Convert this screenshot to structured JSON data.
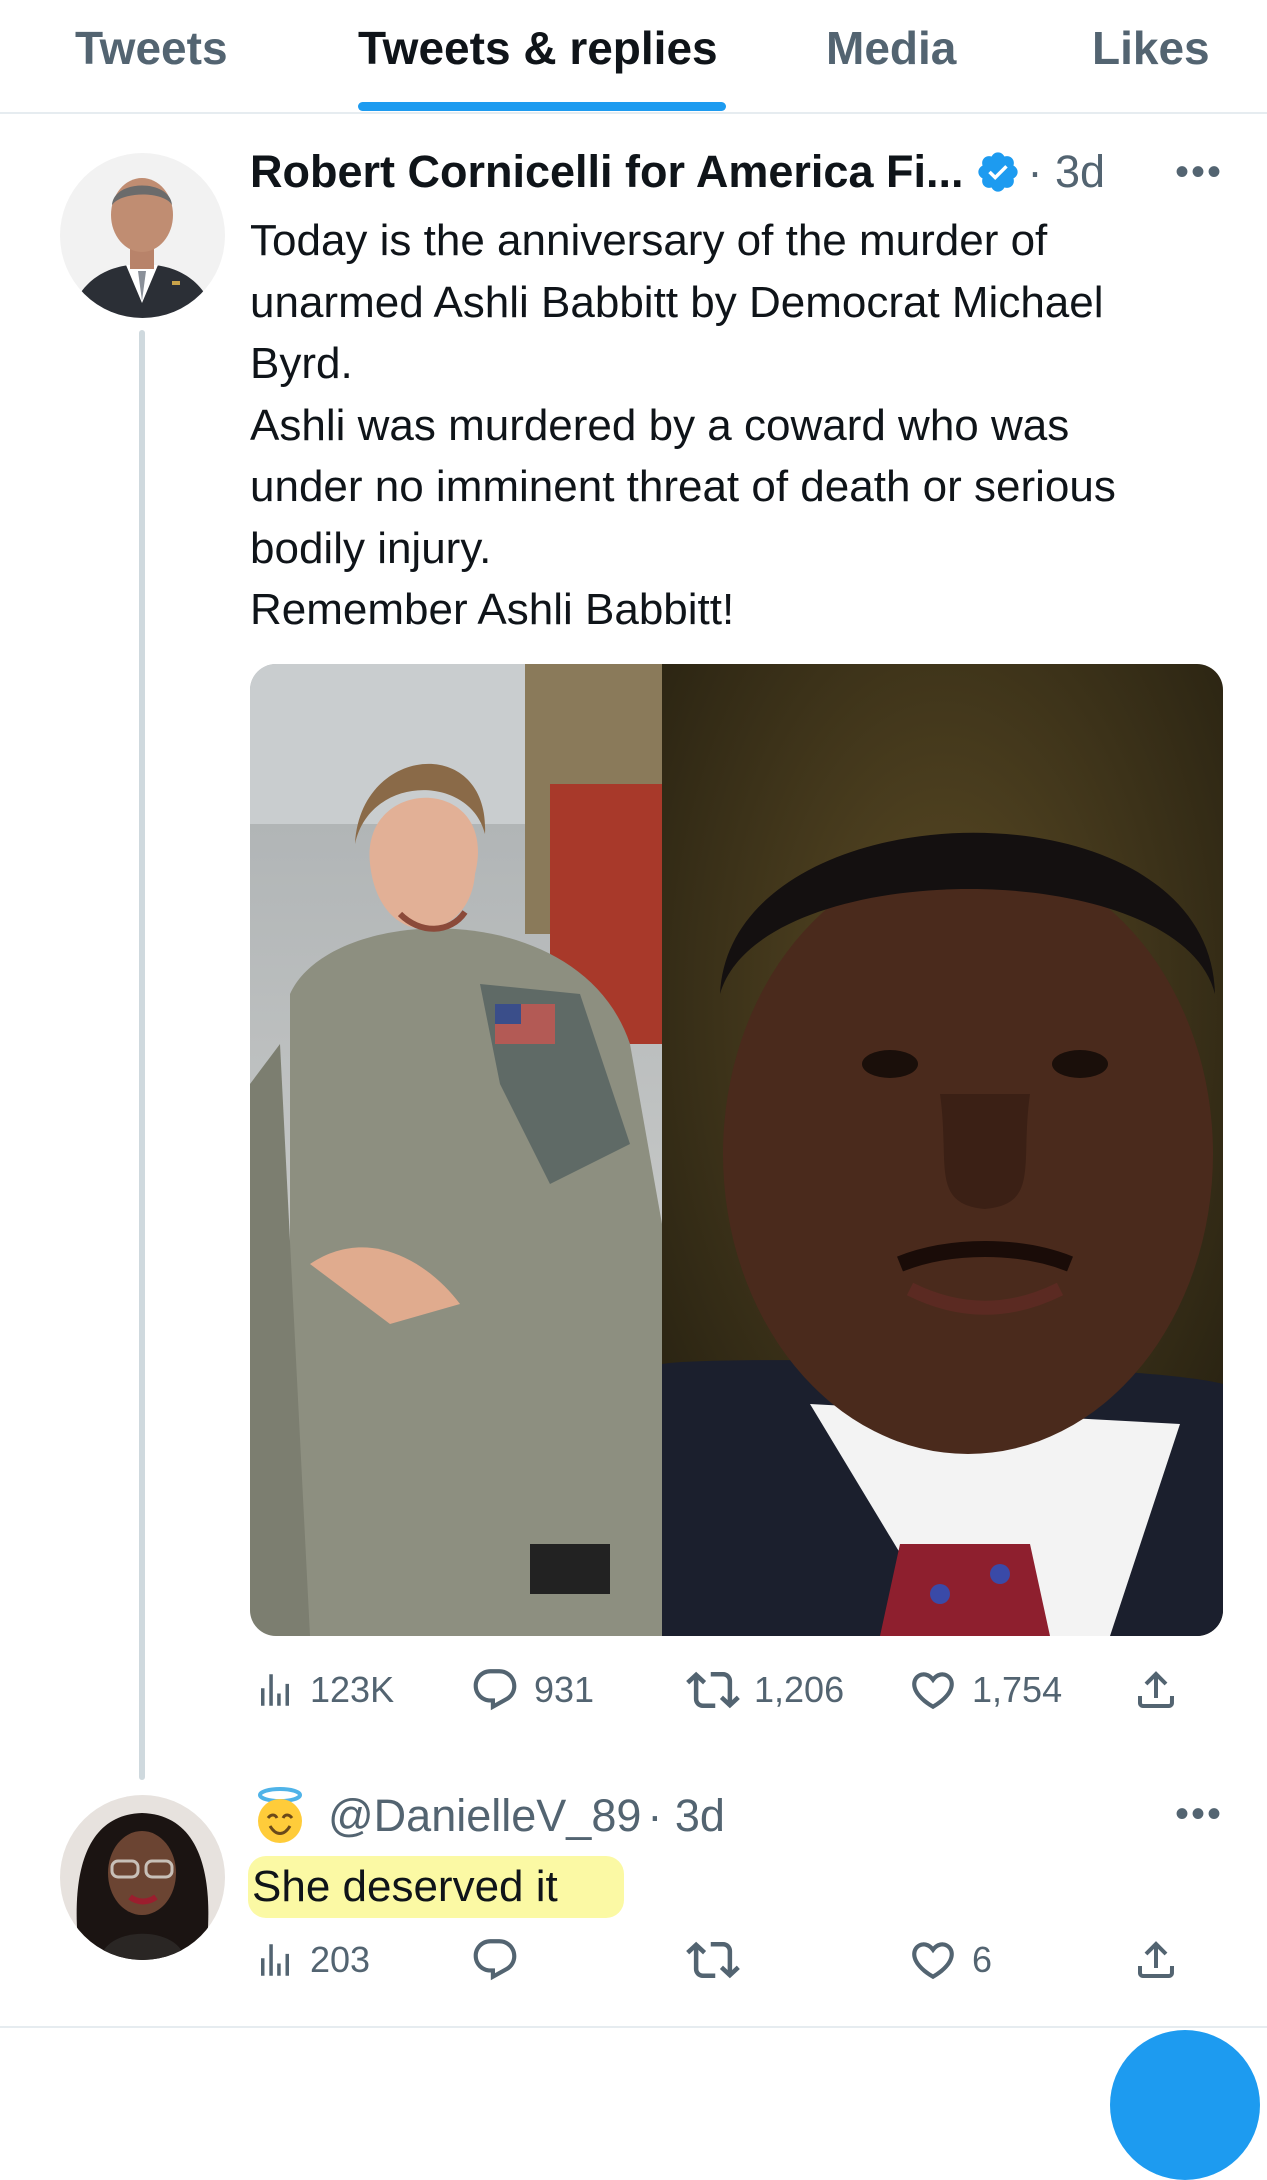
{
  "tabs": [
    {
      "label": "Tweets"
    },
    {
      "label": "Tweets & replies",
      "active": true
    },
    {
      "label": "Media"
    },
    {
      "label": "Likes"
    }
  ],
  "tweet": {
    "author": "Robert Cornicelli for America Fi...",
    "verified": true,
    "time": "· 3d",
    "text_lines": [
      "Today is the anniversary of the murder of",
      "unarmed Ashli Babbitt by Democrat Michael",
      "Byrd.",
      "Ashli was murdered by a coward who was",
      "under no imminent threat of death or serious",
      "bodily injury.",
      "Remember Ashli Babbitt!"
    ],
    "stats": {
      "views": "123K",
      "replies": "931",
      "retweets": "1,206",
      "likes": "1,754"
    }
  },
  "reply": {
    "emoji": "😇",
    "handle": "@DanielleV_89",
    "time": "· 3d",
    "text": "She deserved it",
    "highlight_color": "#fbf9a4",
    "stats": {
      "views": "203",
      "likes": "6"
    }
  },
  "colors": {
    "accent": "#1d9bf0",
    "text": "#0f1419",
    "secondary": "#536471",
    "divider": "#e6ecf0"
  }
}
